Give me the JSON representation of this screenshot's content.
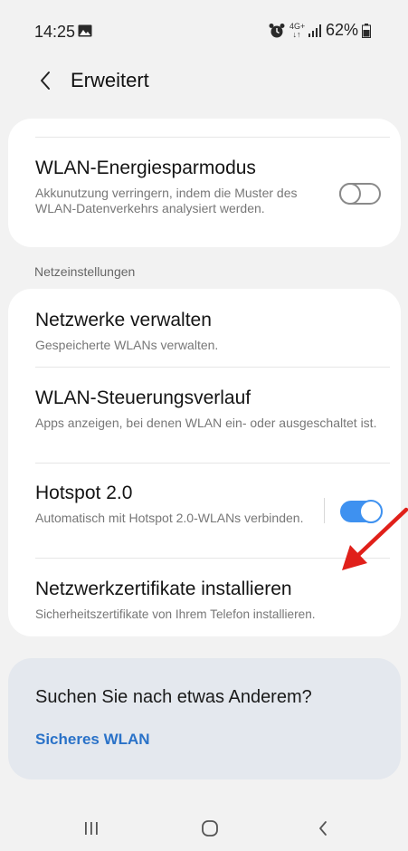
{
  "status_bar": {
    "time": "14:25",
    "network_label": "4G+\n↓↑",
    "battery": "62%",
    "icons": [
      "image-icon",
      "alarm-icon",
      "network-type-icon",
      "signal-icon",
      "battery-icon"
    ]
  },
  "header": {
    "title": "Erweitert",
    "back_icon": "chevron-left-icon"
  },
  "power_saving": {
    "title": "WLAN-Energiesparmodus",
    "subtitle": "Akkunutzung verringern, indem die Muster des WLAN-Datenverkehrs analysiert werden.",
    "enabled": false
  },
  "section_label": "Netzeinstellungen",
  "network_settings": [
    {
      "title": "Netzwerke verwalten",
      "subtitle": "Gespeicherte WLANs verwalten."
    },
    {
      "title": "WLAN-Steuerungsverlauf",
      "subtitle": "Apps anzeigen, bei denen WLAN ein- oder ausgeschaltet ist."
    },
    {
      "title": "Hotspot 2.0",
      "subtitle": "Automatisch mit Hotspot 2.0-WLANs verbinden.",
      "enabled": true
    },
    {
      "title": "Netzwerkzertifikate installieren",
      "subtitle": "Sicherheitszertifikate von Ihrem Telefon installieren."
    }
  ],
  "suggestion": {
    "title": "Suchen Sie nach etwas Anderem?",
    "link": "Sicheres WLAN"
  },
  "colors": {
    "accent": "#3e91f0",
    "link": "#2a72c8",
    "annotation_arrow": "#e0201a",
    "background": "#f2f2f2",
    "card": "#ffffff",
    "suggestion_card": "#e4e8ee"
  },
  "nav_bar": {
    "icons": [
      "recent-apps-icon",
      "home-icon",
      "back-icon"
    ]
  }
}
